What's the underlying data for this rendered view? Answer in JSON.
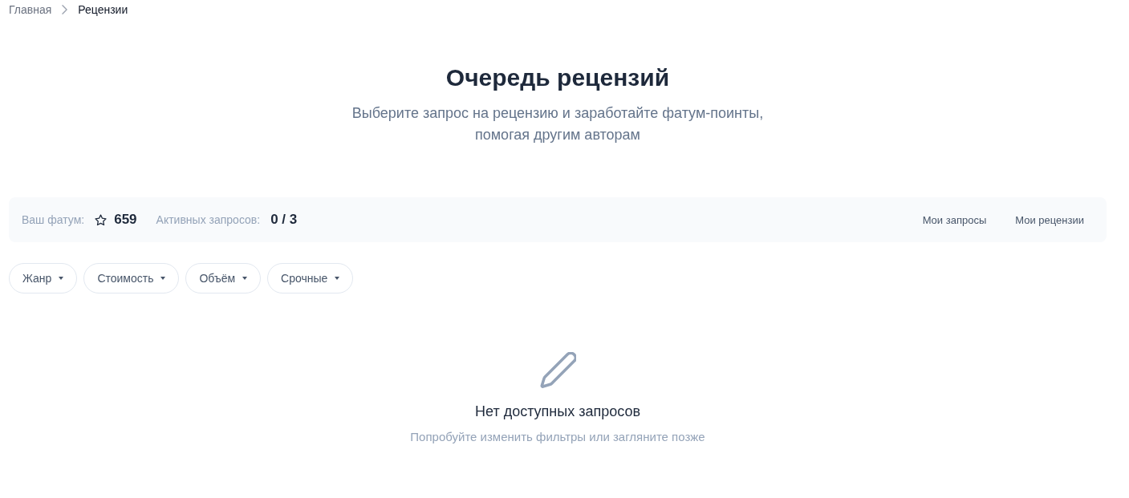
{
  "breadcrumb": [
    {
      "label": "Главная",
      "current": false
    },
    {
      "label": "Рецензии",
      "current": true
    }
  ],
  "header": {
    "title": "Очередь рецензий",
    "subtitle_lines": [
      "Выберите запрос на рецензию и заработайте фатум-поинты,",
      "помогая другим авторам"
    ]
  },
  "stats_bar": {
    "stats": [
      {
        "kind": "points",
        "label": "Ваш фатум:",
        "value": "659"
      },
      {
        "kind": "count",
        "label": "Активных запросов:",
        "value": "0 / 3"
      }
    ],
    "links": [
      "Мои запросы",
      "Мои рецензии"
    ]
  },
  "filters": [
    {
      "label": "Жанр"
    },
    {
      "label": "Стоимость"
    },
    {
      "label": "Объём"
    },
    {
      "label": "Срочные"
    }
  ],
  "empty_state": {
    "title": "Нет доступных запросов",
    "hint": "Попробуйте изменить фильтры или загляните позже"
  }
}
